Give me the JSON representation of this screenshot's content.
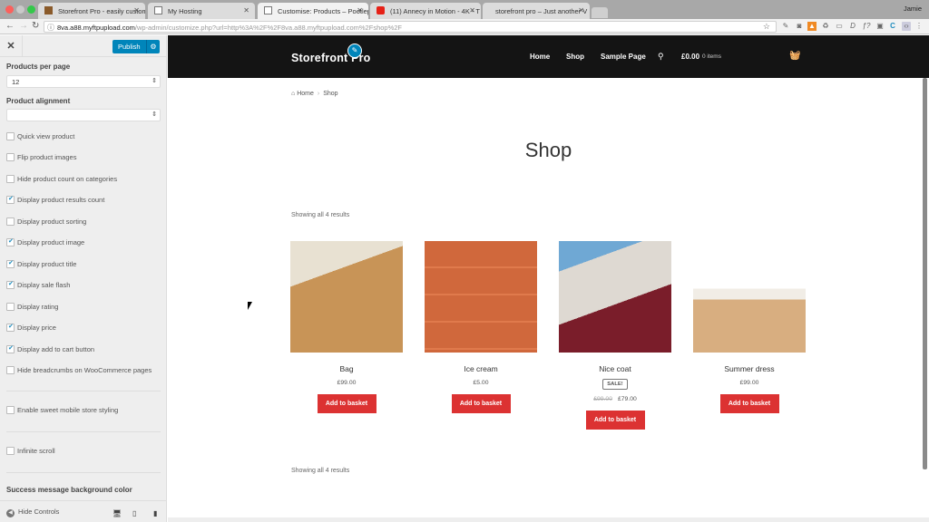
{
  "browser": {
    "tabs": [
      {
        "title": "Storefront Pro - easily customi",
        "icon": "site-favicon",
        "active": false
      },
      {
        "title": "My Hosting",
        "icon": "page-icon",
        "active": false
      },
      {
        "title": "Customise: Products – Pootlep",
        "icon": "page-icon",
        "active": true
      },
      {
        "title": "(11) Annecy in Motion - 4K - T",
        "icon": "youtube-icon",
        "active": false
      },
      {
        "title": "storefront pro – Just another V",
        "icon": "page-icon",
        "active": false
      }
    ],
    "user": "Jamie",
    "url_host": "8va.a88.myftpupload.com",
    "url_path": "/wp-admin/customize.php?url=http%3A%2F%2F8va.a88.myftpupload.com%2Fshop%2F"
  },
  "customizer": {
    "publish_label": "Publish",
    "products_per_page_label": "Products per page",
    "products_per_page_value": "12",
    "product_alignment_label": "Product alignment",
    "product_alignment_value": "",
    "options": [
      {
        "label": "Quick view product",
        "checked": false
      },
      {
        "label": "Flip product images",
        "checked": false
      },
      {
        "label": "Hide product count on categories",
        "checked": false
      },
      {
        "label": "Display product results count",
        "checked": true
      },
      {
        "label": "Display product sorting",
        "checked": false
      },
      {
        "label": "Display product image",
        "checked": true
      },
      {
        "label": "Display product title",
        "checked": true
      },
      {
        "label": "Display sale flash",
        "checked": true
      },
      {
        "label": "Display rating",
        "checked": false
      },
      {
        "label": "Display price",
        "checked": true
      },
      {
        "label": "Display add to cart button",
        "checked": true
      },
      {
        "label": "Hide breadcrumbs on WooCommerce pages",
        "checked": false
      }
    ],
    "mobile_styling": {
      "label": "Enable sweet mobile store styling",
      "checked": false
    },
    "infinite_scroll": {
      "label": "Infinite scroll",
      "checked": false
    },
    "success_color_label": "Success message background color",
    "hide_controls_label": "Hide Controls"
  },
  "site": {
    "logo": "Storefront Pro",
    "nav": [
      "Home",
      "Shop",
      "Sample Page"
    ],
    "cart_amount": "£0.00",
    "cart_items": "0 items",
    "breadcrumb": [
      "Home",
      "Shop"
    ],
    "page_title": "Shop",
    "result_count": "Showing all 4 results",
    "products": [
      {
        "name": "Bag",
        "price": "£99.00",
        "old_price": "",
        "sale": "",
        "button": "Add to basket"
      },
      {
        "name": "Ice cream",
        "price": "£5.00",
        "old_price": "",
        "sale": "",
        "button": "Add to basket"
      },
      {
        "name": "Nice coat",
        "price": "£79.00",
        "old_price": "£99.00",
        "sale": "SALE!",
        "button": "Add to basket"
      },
      {
        "name": "Summer dress",
        "price": "£99.00",
        "old_price": "",
        "sale": "",
        "button": "Add to basket"
      }
    ]
  },
  "colors": {
    "publish": "#0085ba",
    "header_bg": "#141414",
    "add_button": "#dc3232",
    "checkbox_tick": "#1e8cbe"
  }
}
